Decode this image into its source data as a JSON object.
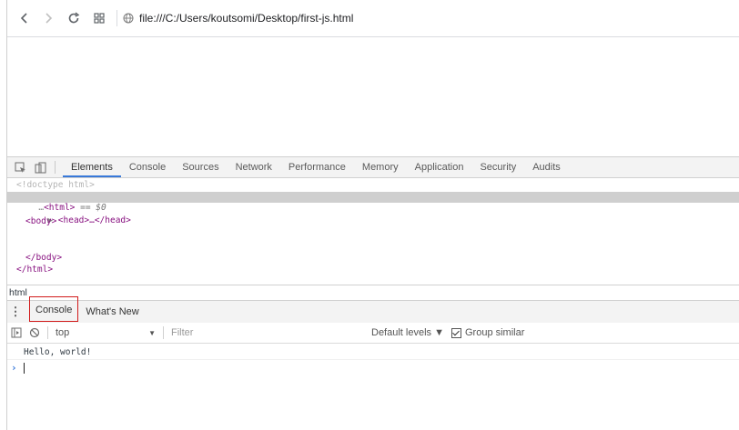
{
  "browser": {
    "url": "file:///C:/Users/koutsomi/Desktop/first-js.html",
    "icons": [
      "back-icon",
      "forward-icon",
      "reload-icon",
      "apps-icon",
      "globe-icon"
    ]
  },
  "devtools": {
    "tabs": [
      "Elements",
      "Console",
      "Sources",
      "Network",
      "Performance",
      "Memory",
      "Application",
      "Security",
      "Audits"
    ],
    "active_tab": "Elements",
    "dom_lines": {
      "doctype": "<!doctype html>",
      "html_open": "<html>",
      "selected_hint": "== $0",
      "head": "<head>…</head>",
      "body_open": "<body>",
      "body_close": "</body>",
      "html_close": "</html>"
    },
    "breadcrumb": "html"
  },
  "drawer": {
    "tabs": [
      "Console",
      "What's New"
    ],
    "active_tab": "Console"
  },
  "console": {
    "context": "top",
    "filter_placeholder": "Filter",
    "levels": "Default levels ▼",
    "group_similar": "Group similar",
    "output": "Hello, world!"
  },
  "colors": {
    "accent": "#3879d9",
    "highlight_box": "#d11a1a",
    "tag_color": "#881280"
  }
}
